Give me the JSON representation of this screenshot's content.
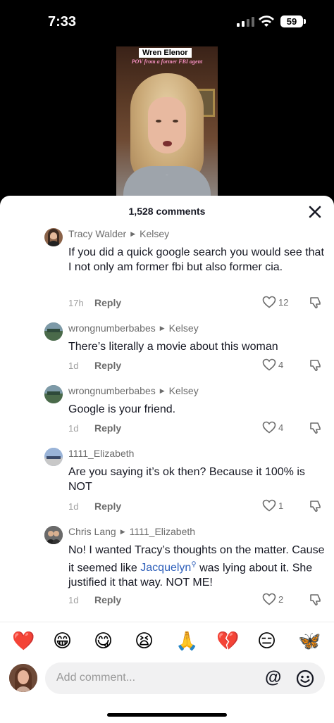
{
  "status_bar": {
    "time": "7:33",
    "battery": "59",
    "icons": [
      "signal-icon",
      "wifi-icon",
      "battery-icon"
    ]
  },
  "video": {
    "title": "Wren Elenor",
    "subtitle": "POV from a former FBI agent",
    "caption": "...",
    "background_tone": "#5a3a26"
  },
  "comments_header": {
    "count": "1,528 comments",
    "close_icon": "close-icon"
  },
  "comments": [
    {
      "author": "Tracy Walder",
      "reply_to": "Kelsey",
      "text": "If you did a quick google search you would see that I not only am former fbi but also former cia.",
      "time": "17h",
      "reply_label": "Reply",
      "likes": "12",
      "avatar_color": "#8a6248"
    },
    {
      "author": "wrongnumberbabes",
      "reply_to": "Kelsey",
      "text": "There’s literally a movie about this woman",
      "time": "1d",
      "reply_label": "Reply",
      "likes": "4",
      "avatar_color": "#5e7a6a"
    },
    {
      "author": "wrongnumberbabes",
      "reply_to": "Kelsey",
      "text": "Google is your friend.",
      "time": "1d",
      "reply_label": "Reply",
      "likes": "4",
      "avatar_color": "#5e7a6a"
    },
    {
      "author": "1111_Elizabeth",
      "reply_to": "",
      "text": "Are you saying it’s ok then? Because it 100% is NOT",
      "time": "1d",
      "reply_label": "Reply",
      "likes": "1",
      "avatar_color": "#7a9ac8"
    },
    {
      "author": "Chris Lang",
      "reply_to": "1111_Elizabeth",
      "text_before": "No! I wanted Tracy’s thoughts on the matter. Cause it seemed like ",
      "mention": "Jacquelyn",
      "text_after": " was lying about it. She justified it that way. NOT ME!",
      "time": "1d",
      "reply_label": "Reply",
      "likes": "2",
      "avatar_color": "#4a4a4a"
    }
  ],
  "emoji_bar": [
    "❤️",
    "😁",
    "😋",
    "😫",
    "🙏",
    "💔",
    "😑",
    "🦋"
  ],
  "composer": {
    "placeholder": "Add comment...",
    "at_label": "@",
    "icons": [
      "mention-icon",
      "emoji-icon"
    ]
  }
}
